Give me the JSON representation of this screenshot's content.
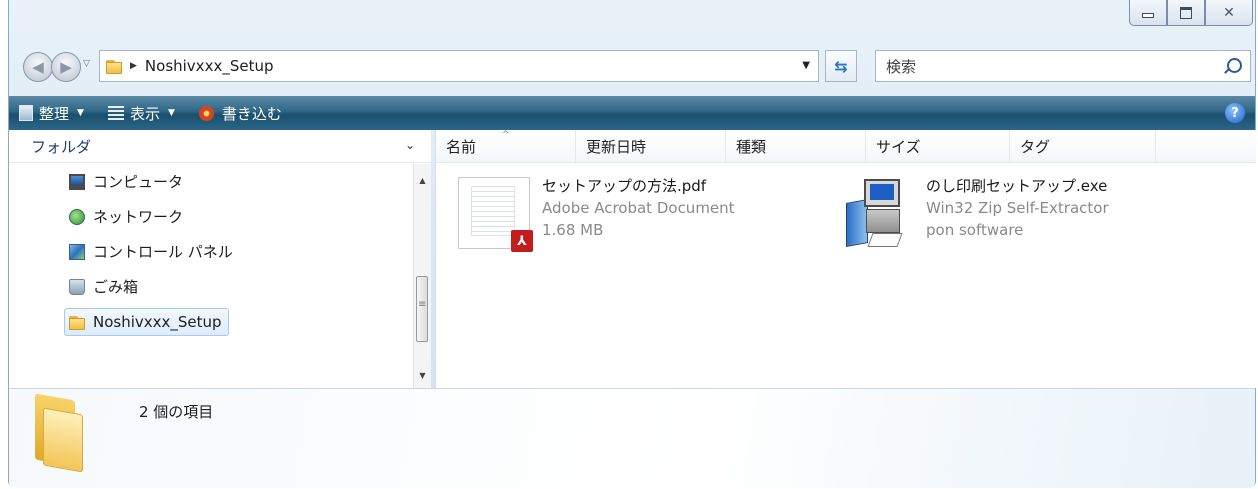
{
  "window": {
    "caption_buttons": {
      "minimize": "minimize",
      "maximize": "maximize",
      "close": "close"
    }
  },
  "address_bar": {
    "path": "Noshivxxx_Setup",
    "search_placeholder": "検索"
  },
  "toolbar": {
    "organize_label": "整理",
    "views_label": "表示",
    "burn_label": "書き込む",
    "help_label": "?"
  },
  "navigation_pane": {
    "header": "フォルダ",
    "items": [
      {
        "label": "コンピュータ",
        "icon": "computer-icon"
      },
      {
        "label": "ネットワーク",
        "icon": "network-icon"
      },
      {
        "label": "コントロール パネル",
        "icon": "control-panel-icon"
      },
      {
        "label": "ごみ箱",
        "icon": "recycle-bin-icon"
      },
      {
        "label": "Noshivxxx_Setup",
        "icon": "folder-icon",
        "selected": true
      }
    ]
  },
  "columns": [
    "名前",
    "更新日時",
    "種類",
    "サイズ",
    "タグ"
  ],
  "files": [
    {
      "name": "セットアップの方法.pdf",
      "type": "Adobe Acrobat Document",
      "size": "1.68 MB",
      "icon": "pdf-icon"
    },
    {
      "name": "のし印刷セットアップ.exe",
      "type": "Win32 Zip Self-Extractor",
      "publisher": "pon software",
      "icon": "installer-icon"
    }
  ],
  "details_pane": {
    "item_count": "2 個の項目"
  }
}
